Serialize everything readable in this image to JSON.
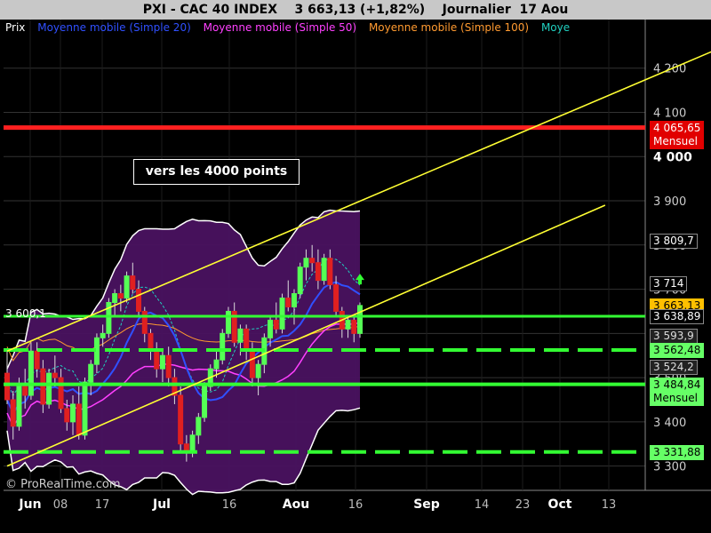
{
  "chart_data": {
    "type": "candlestick",
    "title": "PXI - CAC 40 INDEX    3 663,13 (+1,82%)    Journalier  17 Aou",
    "legend": [
      "Prix",
      "Moyenne mobile (Simple 20)",
      "Moyenne mobile (Simple 50)",
      "Moyenne mobile (Simple 100)",
      "Moye"
    ],
    "annotation": "vers les 4000 points",
    "y_ticks": [
      "4 200",
      "4 100",
      "4 000",
      "3 900",
      "3 800",
      "3 700",
      "3 600",
      "3 500",
      "3 400",
      "3 300"
    ],
    "x_ticks": [
      "Jun",
      "08",
      "17",
      "Jul",
      "16",
      "Aou",
      "16",
      "Sep",
      "14",
      "23",
      "Oct",
      "13"
    ],
    "ylim": [
      3245,
      4310
    ],
    "price_labels": [
      {
        "text": "4 065,65\nMensuel",
        "value": 4065.65,
        "style": "red"
      },
      {
        "text": "3 809,7",
        "value": 3809.7,
        "style": "white"
      },
      {
        "text": "3 714",
        "value": 3714,
        "style": "white"
      },
      {
        "text": "3 663,13",
        "value": 3663.13,
        "style": "gold"
      },
      {
        "text": "3 638,89",
        "value": 3638.89,
        "style": "white"
      },
      {
        "text": "3 593,9",
        "value": 3593.9,
        "style": "grey"
      },
      {
        "text": "3 562,48",
        "value": 3562.48,
        "style": "green"
      },
      {
        "text": "3 524,2",
        "value": 3524.2,
        "style": "grey"
      },
      {
        "text": "3 484,84\nMensuel",
        "value": 3484.84,
        "style": "green"
      },
      {
        "text": "3 331,88",
        "value": 3331.88,
        "style": "green"
      }
    ],
    "left_label": "3 600,1",
    "horizontal_lines": [
      {
        "value": 4065.65,
        "color": "#ff2020",
        "style": "solid",
        "width": 5
      },
      {
        "value": 3638.89,
        "color": "#33ff33",
        "style": "solid",
        "width": 3
      },
      {
        "value": 3562.48,
        "color": "#33ff33",
        "style": "dashed",
        "width": 4
      },
      {
        "value": 3484.84,
        "color": "#33ff33",
        "style": "solid",
        "width": 4
      },
      {
        "value": 3331.88,
        "color": "#33ff33",
        "style": "dashed",
        "width": 4
      }
    ],
    "channel": {
      "upper": [
        [
          0,
          3560
        ],
        [
          120,
          4250
        ]
      ],
      "lower": [
        [
          0,
          3300
        ],
        [
          100,
          3890
        ]
      ]
    },
    "candles": [
      [
        3510,
        3560,
        3440,
        3450
      ],
      [
        3450,
        3470,
        3360,
        3390
      ],
      [
        3390,
        3500,
        3380,
        3480
      ],
      [
        3480,
        3520,
        3430,
        3460
      ],
      [
        3460,
        3580,
        3450,
        3560
      ],
      [
        3560,
        3580,
        3500,
        3520
      ],
      [
        3520,
        3540,
        3420,
        3440
      ],
      [
        3440,
        3520,
        3430,
        3510
      ],
      [
        3510,
        3550,
        3480,
        3500
      ],
      [
        3500,
        3520,
        3420,
        3430
      ],
      [
        3430,
        3450,
        3380,
        3400
      ],
      [
        3400,
        3460,
        3370,
        3440
      ],
      [
        3440,
        3480,
        3360,
        3370
      ],
      [
        3370,
        3500,
        3360,
        3490
      ],
      [
        3490,
        3540,
        3460,
        3530
      ],
      [
        3530,
        3600,
        3510,
        3590
      ],
      [
        3590,
        3620,
        3570,
        3600
      ],
      [
        3600,
        3680,
        3590,
        3670
      ],
      [
        3670,
        3700,
        3640,
        3690
      ],
      [
        3690,
        3710,
        3650,
        3680
      ],
      [
        3680,
        3740,
        3670,
        3730
      ],
      [
        3730,
        3760,
        3690,
        3700
      ],
      [
        3700,
        3720,
        3640,
        3650
      ],
      [
        3650,
        3660,
        3580,
        3600
      ],
      [
        3600,
        3610,
        3540,
        3560
      ],
      [
        3560,
        3580,
        3500,
        3520
      ],
      [
        3520,
        3560,
        3490,
        3550
      ],
      [
        3550,
        3570,
        3480,
        3500
      ],
      [
        3500,
        3520,
        3440,
        3460
      ],
      [
        3460,
        3480,
        3330,
        3350
      ],
      [
        3350,
        3370,
        3310,
        3330
      ],
      [
        3330,
        3380,
        3320,
        3370
      ],
      [
        3370,
        3420,
        3350,
        3410
      ],
      [
        3410,
        3490,
        3400,
        3480
      ],
      [
        3480,
        3530,
        3470,
        3520
      ],
      [
        3520,
        3560,
        3500,
        3540
      ],
      [
        3540,
        3610,
        3530,
        3600
      ],
      [
        3600,
        3660,
        3590,
        3650
      ],
      [
        3650,
        3670,
        3570,
        3580
      ],
      [
        3580,
        3620,
        3550,
        3610
      ],
      [
        3610,
        3620,
        3540,
        3560
      ],
      [
        3560,
        3580,
        3480,
        3500
      ],
      [
        3500,
        3540,
        3460,
        3530
      ],
      [
        3530,
        3600,
        3510,
        3590
      ],
      [
        3590,
        3640,
        3570,
        3630
      ],
      [
        3630,
        3670,
        3600,
        3610
      ],
      [
        3610,
        3690,
        3600,
        3680
      ],
      [
        3680,
        3720,
        3650,
        3660
      ],
      [
        3660,
        3700,
        3620,
        3690
      ],
      [
        3690,
        3760,
        3680,
        3750
      ],
      [
        3750,
        3790,
        3720,
        3770
      ],
      [
        3770,
        3800,
        3740,
        3760
      ],
      [
        3760,
        3790,
        3700,
        3720
      ],
      [
        3720,
        3780,
        3710,
        3770
      ],
      [
        3770,
        3790,
        3700,
        3710
      ],
      [
        3710,
        3730,
        3640,
        3650
      ],
      [
        3650,
        3660,
        3590,
        3610
      ],
      [
        3610,
        3640,
        3590,
        3630
      ],
      [
        3630,
        3640,
        3580,
        3600
      ],
      [
        3600,
        3670,
        3590,
        3663.13
      ]
    ]
  }
}
